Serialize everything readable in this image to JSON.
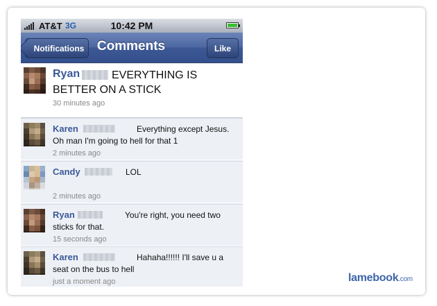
{
  "statusbar": {
    "carrier": "AT&T",
    "network": "3G",
    "time": "10:42 PM"
  },
  "navbar": {
    "back_label": "Notifications",
    "title": "Comments",
    "like_label": "Like"
  },
  "post": {
    "author": "Ryan",
    "text": "EVERYTHING IS BETTER ON A STICK",
    "time": "30 minutes ago"
  },
  "comments": [
    {
      "author": "Karen",
      "text": "Everything except Jesus.  Oh man I'm going to hell for that 1",
      "time": "2 minutes ago"
    },
    {
      "author": "Candy",
      "text": "LOL",
      "time": "2 minutes ago"
    },
    {
      "author": "Ryan",
      "text": "You're right, you need two sticks for that.",
      "time": "15 seconds ago"
    },
    {
      "author": "Karen",
      "text": "Hahaha!!!!!! I'll save u a seat on the bus to hell",
      "time": "just a moment ago"
    }
  ],
  "branding": {
    "logo": "lamebook",
    "logo_suffix": ".com"
  },
  "colors": {
    "nav_blue": "#3d5894",
    "name_blue": "#3b5998",
    "logo_blue": "#3e66a8"
  }
}
